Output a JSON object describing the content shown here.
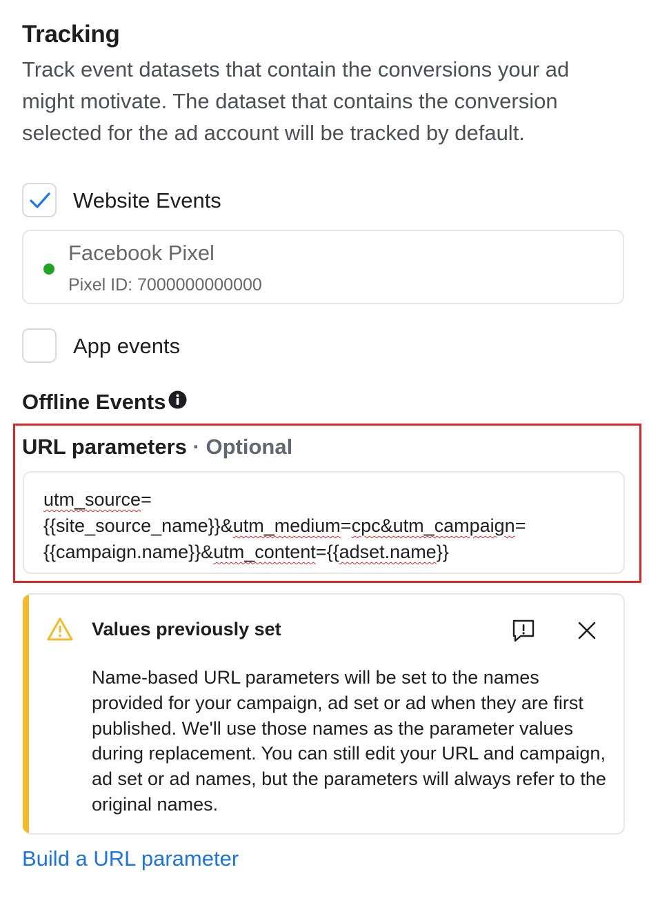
{
  "tracking": {
    "title": "Tracking",
    "description": "Track event datasets that contain the conversions your ad might motivate. The dataset that contains the conversion selected for the ad account will be tracked by default."
  },
  "website_events": {
    "label": "Website Events",
    "checked": true
  },
  "pixel": {
    "name": "Facebook Pixel",
    "id_text": "Pixel ID: 7000000000000",
    "status_color": "#1da61f"
  },
  "app_events": {
    "label": "App events",
    "checked": false
  },
  "offline_events": {
    "label": "Offline Events",
    "icon": "info-icon"
  },
  "url_parameters": {
    "label": "URL parameters",
    "optional_label": "· Optional",
    "value": "utm_source={{site_source_name}}&utm_medium=cpc&utm_campaign={{campaign.name}}&utm_content={{adset.name}}",
    "line1a": "utm_source",
    "line1b": "=",
    "line2a": "{{site_source_name}}&",
    "line2b": "utm_medium",
    "line2c": "=",
    "line2d": "cpc&utm_campaign",
    "line2e": "=",
    "line3a": "{{campaign.name}}&",
    "line3b": "utm_content",
    "line3c": "={{",
    "line3d": "adset.name",
    "line3e": "}}"
  },
  "warning": {
    "title": "Values previously set",
    "body": "Name-based URL parameters will be set to the names provided for your campaign, ad set or ad when they are first published. We'll use those names as the parameter values during replacement. You can still edit your URL and campaign, ad set or ad names, but the parameters will always refer to the original names.",
    "accent_color": "#f7b928"
  },
  "build_link": {
    "label": "Build a URL parameter"
  },
  "colors": {
    "highlight_border": "#e02424",
    "link": "#1a73e8",
    "check": "#1877f2"
  }
}
